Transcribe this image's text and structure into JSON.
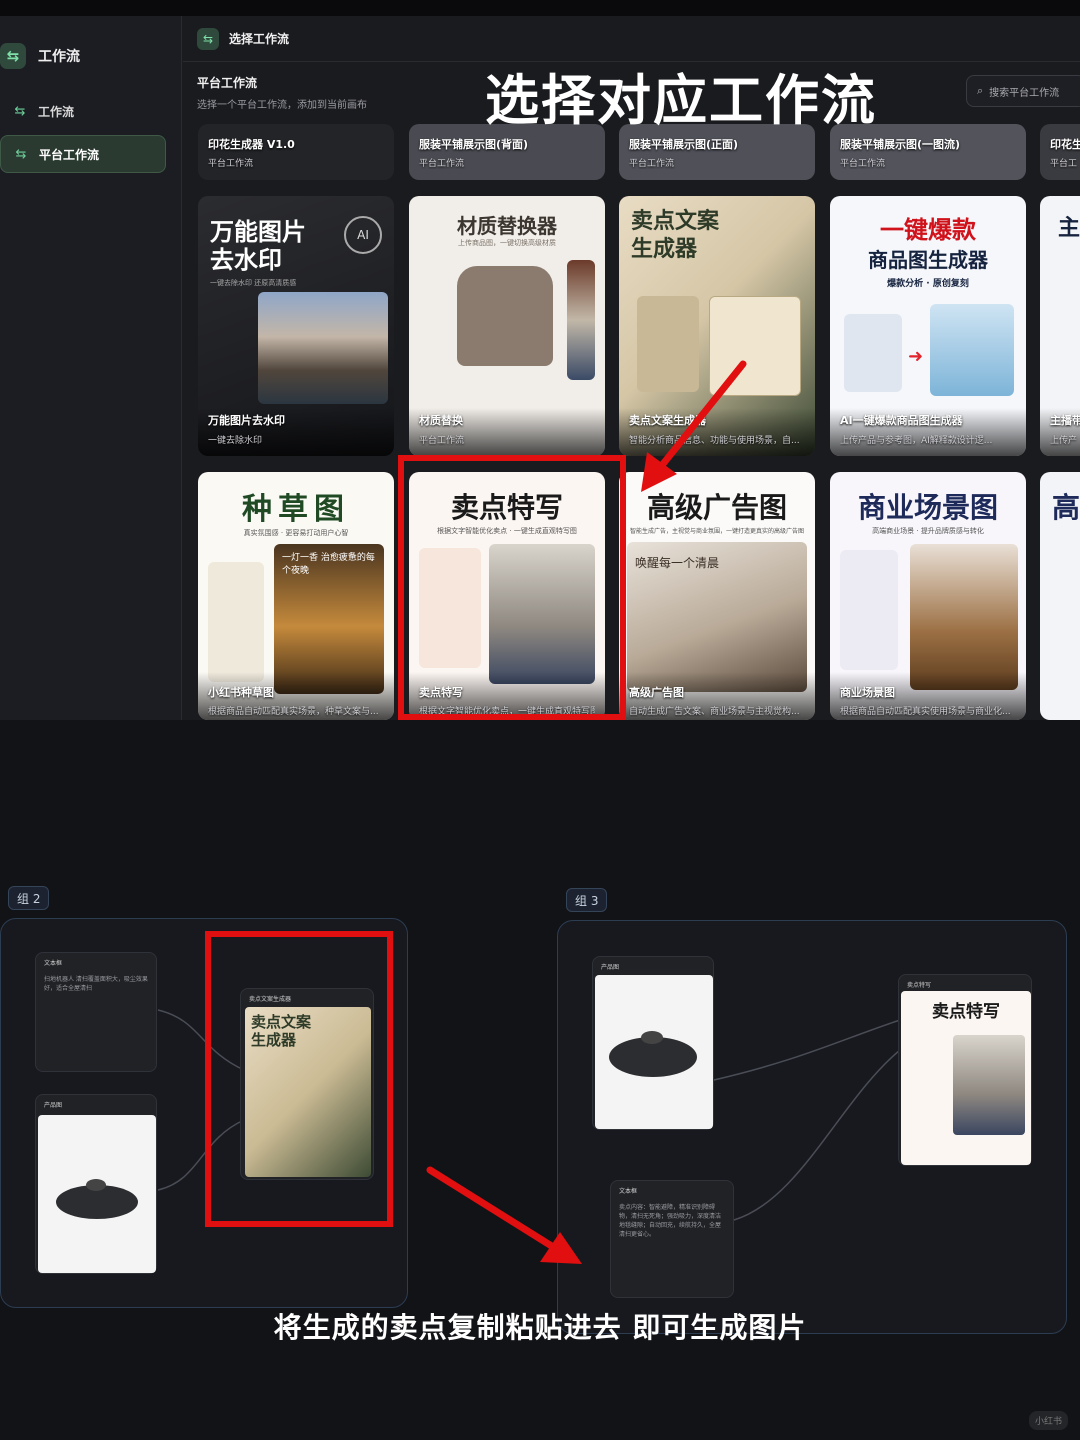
{
  "colors": {
    "accent_green": "#6ed09b",
    "highlight_red": "#e10f0f",
    "sidebar_bg": "#1c1d22",
    "panel_bg": "#1a1b1f"
  },
  "sidebar": {
    "title": "工作流",
    "title_icon": "workflow-icon",
    "items": [
      {
        "label": "工作流",
        "icon": "workflow-icon",
        "active": false
      },
      {
        "label": "平台工作流",
        "icon": "workflow-icon",
        "active": true
      }
    ]
  },
  "main": {
    "header_title": "选择工作流",
    "section_title": "平台工作流",
    "section_subtitle": "选择一个平台工作流，添加到当前画布",
    "search_placeholder": "搜索平台工作流",
    "overlay_title": "选择对应工作流"
  },
  "cards_row1": [
    {
      "name": "印花生成器 V1.0",
      "sub": "平台工作流"
    },
    {
      "name": "服装平铺展示图(背面)",
      "sub": "平台工作流"
    },
    {
      "name": "服装平铺展示图(正面)",
      "sub": "平台工作流"
    },
    {
      "name": "服装平铺展示图(一图流)",
      "sub": "平台工作流"
    },
    {
      "name": "印花生",
      "sub": "平台工"
    }
  ],
  "cards_row2": [
    {
      "name": "万能图片去水印",
      "sub": "一键去除水印",
      "cover_title": "万能图片去水印",
      "cover_line1": "万能图片",
      "cover_line2": "去水印",
      "cover_tag": "一键去除水印 还原高清质感"
    },
    {
      "name": "材质替换",
      "sub": "平台工作流",
      "cover_title": "材质替换器",
      "cover_tag": "上传商品图，一键切换高级材质"
    },
    {
      "name": "卖点文案生成器",
      "sub": "智能分析商品信息、功能与使用场景，自...",
      "cover_line1": "卖点文案",
      "cover_line2": "生成器"
    },
    {
      "name": "AI一键爆款商品图生成器",
      "sub": "上传产品与参考图，AI解释款设计逻...",
      "cover_line1": "一键爆款",
      "cover_line2": "商品图生成器",
      "cover_tag": "爆款分析 · 原创复刻"
    },
    {
      "name": "主播带",
      "sub": "上传产",
      "cover_line1": "主"
    }
  ],
  "cards_row3": [
    {
      "name": "小红书种草图",
      "sub": "根据商品自动匹配真实场景，种草文案与...",
      "cover_title": "种草图",
      "cover_tag": "真实氛围感 · 更容易打动用户心智",
      "cover_note": "一灯一香 治愈疲惫的每个夜晚"
    },
    {
      "name": "卖点特写",
      "sub": "根据文字智能优化卖点，一键生成直观特写图",
      "cover_title": "卖点特写",
      "cover_tag": "根据文字智能优化卖点 · 一键生成直观特写图"
    },
    {
      "name": "高级广告图",
      "sub": "自动生成广告文案、商业场景与主视觉构...",
      "cover_title": "高级广告图",
      "cover_tag": "智能生成广告，主视觉与商业氛围，一键打造更真实的高级广告图",
      "cover_note": "唤醒每一个清晨"
    },
    {
      "name": "商业场景图",
      "sub": "根据商品自动匹配真实使用场景与商业化...",
      "cover_title": "商业场景图",
      "cover_tag": "高端商业场景 · 提升品牌质感与转化"
    },
    {
      "name": "高",
      "sub": "",
      "cover_title": "高"
    }
  ],
  "canvas": {
    "group2_label": "组 2",
    "group3_label": "组 3",
    "node_text_title": "文本框",
    "node_text_body": "扫地机器人 清扫覆盖面积大，吸尘效果好，适合全屋清扫",
    "node_product_title": "产品图",
    "node_seller_title": "卖点文案生成器",
    "node_seller_cover_line1": "卖点文案",
    "node_seller_cover_line2": "生成器",
    "node_product2_title": "产品图",
    "node_output_title": "卖点特写",
    "node_output_cover_title": "卖点特写",
    "node_prompt_title": "文本框",
    "node_prompt_body": "卖点内容：智能避障，精准识别障碍物，清扫无死角；强劲吸力，深度清洁地毯缝隙；自动回充，续航持久，全屋清扫更省心。",
    "caption": "将生成的卖点复制粘贴进去 即可生成图片",
    "watermark": "小红书"
  }
}
